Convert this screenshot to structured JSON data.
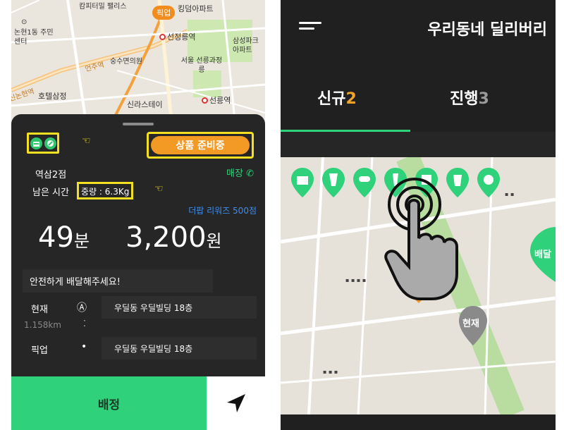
{
  "left_screen": {
    "map": {
      "labels": [
        "캄피터밀 팰리스",
        "킹덤아파트",
        "논현1동 주민센터",
        "선정릉역",
        "숭수면의원",
        "서울 선릉과정릉",
        "삼성파크 아파트",
        "호텔삼정",
        "신라스테이",
        "선릉역",
        "언주역",
        "신논현역"
      ],
      "pickup_pin": "픽업"
    },
    "card": {
      "status_button": "상품 준비중",
      "store_name": "역삼2점",
      "store_link": "매장",
      "remaining_time_label": "남은 시간",
      "weight": "중량 : 6.3Kg",
      "reward": "더팝 리워즈 500점",
      "time_value": "49",
      "time_unit": "분",
      "price_value": "3,200",
      "price_unit": "원",
      "message": "안전하게 배달해주세요!",
      "current_label": "현재",
      "current_address": "우딜동 우딜빌딩 18층",
      "distance": "1.158km",
      "pickup_label": "픽업",
      "pickup_address": "우딜동 우딜빌딩 18층",
      "assign_button": "배정",
      "hint_icon": "pointing-hand-icon"
    }
  },
  "right_screen": {
    "title": "우리동네 딜리버리",
    "tabs": [
      {
        "label": "신규",
        "count": "2",
        "active": true
      },
      {
        "label": "진행",
        "count": "3",
        "active": false
      }
    ],
    "map": {
      "now_pin": "현재",
      "delivery_pin": "배달"
    }
  },
  "colors": {
    "accent_green": "#2fd27a",
    "accent_orange": "#f39a25",
    "highlight_yellow": "#f4e021",
    "link_blue": "#3c8ef0",
    "card_bg": "#262626"
  }
}
